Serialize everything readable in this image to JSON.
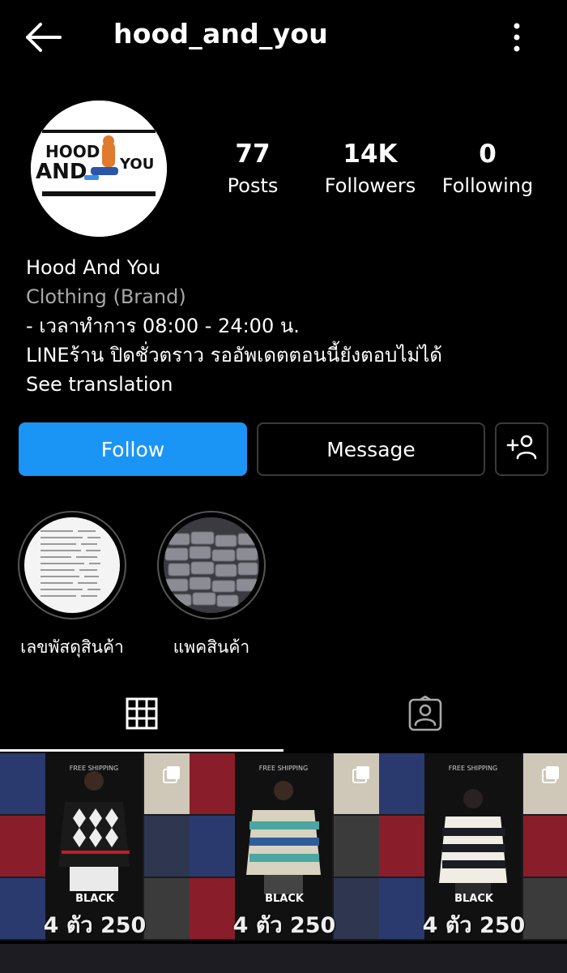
{
  "header": {
    "username": "hood_and_you"
  },
  "profile": {
    "logo_text_top": "HOOD",
    "logo_text_bottom": "AND",
    "logo_text_right": "YOU",
    "stats": {
      "posts_count": "77",
      "posts_label": "Posts",
      "followers_count": "14K",
      "followers_label": "Followers",
      "following_count": "0",
      "following_label": "Following"
    },
    "name": "Hood And You",
    "category": "Clothing (Brand)",
    "bio_line1": "- เวลาทำการ 08:00 - 24:00 น.",
    "bio_line2": "LINEร้าน ปิดชั่วตราว รออัพเดตตอนนี้ยังตอบไม่ได้",
    "see_translation": "See translation"
  },
  "actions": {
    "follow_label": "Follow",
    "message_label": "Message",
    "add_user_icon": "person-plus-icon"
  },
  "highlights": [
    {
      "label": "เลขพัสดุสินค้า"
    },
    {
      "label": "แพคสินค้า"
    }
  ],
  "tabs": {
    "grid_icon": "grid-icon",
    "tagged_icon": "tagged-person-icon"
  },
  "posts": [
    {
      "free_shipping": "FREE SHIPPING",
      "color_label": "BLACK",
      "price": "4 ตัว 250"
    },
    {
      "free_shipping": "FREE SHIPPING",
      "color_label": "BLACK",
      "price": "4 ตัว 250"
    },
    {
      "free_shipping": "FREE SHIPPING",
      "color_label": "BLACK",
      "price": "4 ตัว 250"
    }
  ],
  "colors": {
    "accent": "#1b95f5",
    "secondary_text": "#a8a8a8",
    "background": "#000000"
  }
}
